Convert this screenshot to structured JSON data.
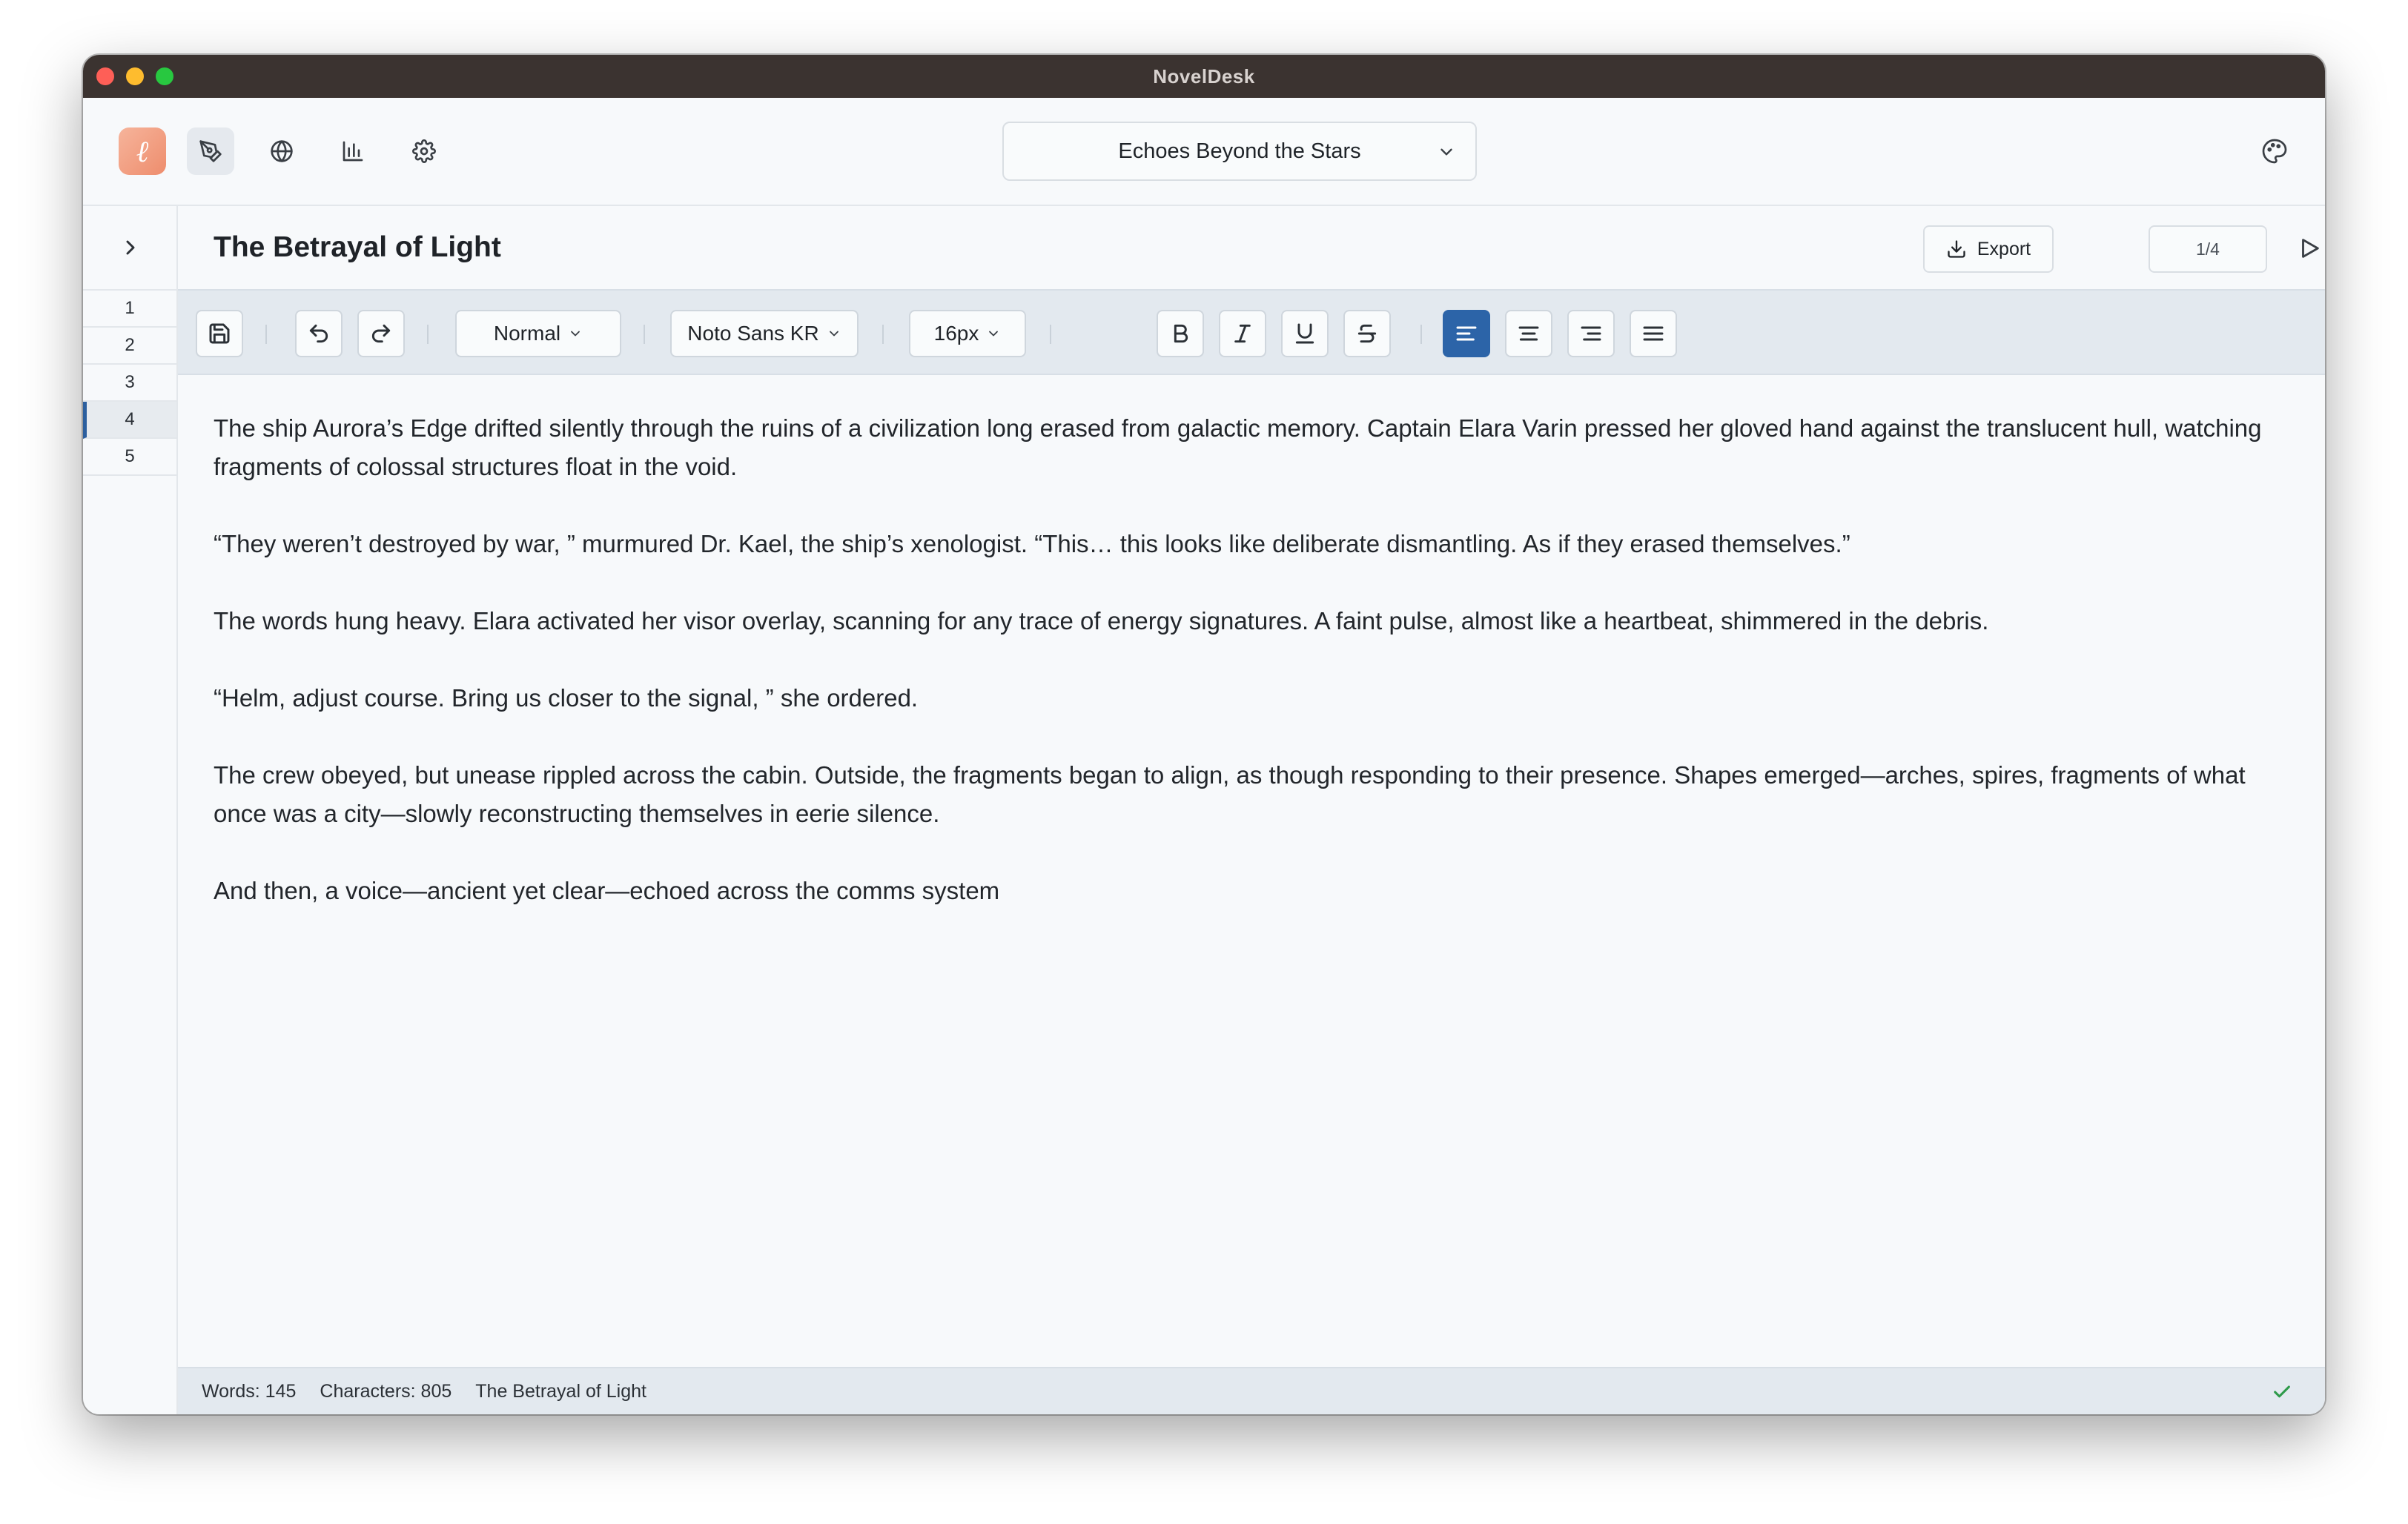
{
  "window": {
    "title": "NovelDesk"
  },
  "nav": {
    "items": [
      {
        "icon": "pen-icon",
        "active": true
      },
      {
        "icon": "globe-icon",
        "active": false
      },
      {
        "icon": "chart-icon",
        "active": false
      },
      {
        "icon": "gear-icon",
        "active": false
      }
    ]
  },
  "project": {
    "selected": "Echoes Beyond the Stars"
  },
  "chapters": {
    "items": [
      "1",
      "2",
      "3",
      "4",
      "5"
    ],
    "active_index": 3
  },
  "document": {
    "title": "The Betrayal of Light",
    "export_label": "Export",
    "page_indicator": "1/4"
  },
  "toolbar": {
    "style": "Normal",
    "font": "Noto Sans KR",
    "size": "16px",
    "alignment_active": "left"
  },
  "content": {
    "paragraphs": [
      "The ship Aurora’s Edge drifted silently through the ruins of a civilization long erased from galactic memory. Captain Elara Varin pressed her gloved hand against the translucent hull, watching fragments of colossal structures float in the void.",
      "“They weren’t destroyed by war, ” murmured Dr. Kael, the ship’s xenologist. “This… this looks like deliberate dismantling. As if they erased themselves.”",
      "The words hung heavy. Elara activated her visor overlay, scanning for any trace of energy signatures. A faint pulse, almost like a heartbeat, shimmered in the debris.",
      "“Helm, adjust course. Bring us closer to the signal, ” she ordered.",
      "The crew obeyed, but unease rippled across the cabin. Outside, the fragments began to align, as though responding to their presence. Shapes emerged—arches, spires, fragments of what once was a city—slowly reconstructing themselves in eerie silence.",
      "And then, a voice—ancient yet clear—echoed across the comms system"
    ]
  },
  "status": {
    "words": "Words: 145",
    "characters": "Characters: 805",
    "chapter": "The Betrayal of Light"
  },
  "colors": {
    "accent": "#2c64a8",
    "logo": "#ee8d6d",
    "status_ok": "#2e9a4a"
  }
}
